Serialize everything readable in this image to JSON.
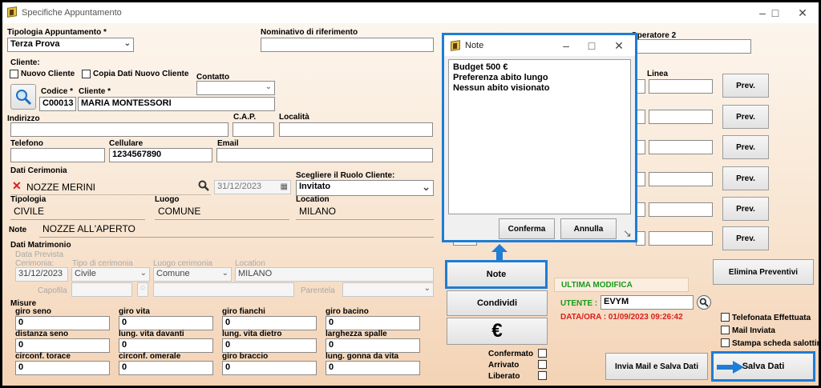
{
  "window": {
    "title": "Specifiche Appuntamento"
  },
  "top": {
    "tipologia_label": "Tipologia Appuntamento *",
    "tipologia_value": "Terza Prova",
    "nominativo_label": "Nominativo di riferimento",
    "nominativo_value": "",
    "operatore_label": "Operatore 2"
  },
  "cliente": {
    "section_label": "Cliente:",
    "nuovo_label": "Nuovo Cliente",
    "copia_label": "Copia Dati Nuovo Cliente",
    "contatto_label": "Contatto",
    "codice_label": "Codice *",
    "codice_value": "C00013",
    "cliente_label": "Cliente *",
    "cliente_value": "MARIA  MONTESSORI",
    "indirizzo_label": "Indirizzo",
    "cap_label": "C.A.P.",
    "localita_label": "Località",
    "telefono_label": "Telefono",
    "cellulare_label": "Cellulare",
    "cellulare_value": "1234567890",
    "email_label": "Email"
  },
  "cerimonia": {
    "section_label": "Dati Cerimonia",
    "name_value": "NOZZE MERINI",
    "date_value": "31/12/2023",
    "ruolo_label": "Scegliere il Ruolo Cliente:",
    "ruolo_value": "Invitato",
    "tipologia_label": "Tipologia",
    "tipologia_value": "CIVILE",
    "luogo_label": "Luogo",
    "luogo_value": "COMUNE",
    "location_label": "Location",
    "location_value": "MILANO",
    "note_label": "Note",
    "note_value": "NOZZE ALL'APERTO"
  },
  "matrimonio": {
    "section_label": "Dati Matrimonio",
    "data_prevista_label": "Data Prevista",
    "cerimonia_label": "Cerimonia:",
    "cerimonia_value": "31/12/2023",
    "tipo_label": "Tipo di cerimonia",
    "tipo_value": "Civile",
    "luogo_label": "Luogo cerimonia",
    "luogo_value": "Comune",
    "location_label": "Location",
    "location_value": "MILANO",
    "capofila_label": "Capofila",
    "parentela_label": "Parentela"
  },
  "misure": {
    "section_label": "Misure",
    "fields": [
      {
        "label": "giro seno",
        "value": "0"
      },
      {
        "label": "giro vita",
        "value": "0"
      },
      {
        "label": "giro fianchi",
        "value": "0"
      },
      {
        "label": "giro bacino",
        "value": "0"
      },
      {
        "label": "distanza seno",
        "value": "0"
      },
      {
        "label": "lung. vita davanti",
        "value": "0"
      },
      {
        "label": "lung. vita dietro",
        "value": "0"
      },
      {
        "label": "larghezza spalle",
        "value": "0"
      },
      {
        "label": "circonf. torace",
        "value": "0"
      },
      {
        "label": "circonf. omerale",
        "value": "0"
      },
      {
        "label": "giro braccio",
        "value": "0"
      },
      {
        "label": "lung. gonna da vita",
        "value": "0"
      }
    ]
  },
  "note_dialog": {
    "title": "Note",
    "lines": [
      "Budget 500 €",
      "Preferenza abito lungo",
      "Nessun abito visionato"
    ],
    "confirm_label": "Conferma",
    "cancel_label": "Annulla"
  },
  "middle": {
    "note_button": "Note",
    "condividi_button": "Condividi",
    "euro_symbol": "€",
    "confermato_label": "Confermato",
    "arrivato_label": "Arrivato",
    "liberato_label": "Liberato"
  },
  "right": {
    "linea_label": "Linea",
    "prev_label": "Prev.",
    "elimina_label": "Elimina Preventivi",
    "ultima_label": "ULTIMA MODIFICA",
    "utente_label": "UTENTE :",
    "utente_value": "EVYM",
    "dataora_label": "DATA/ORA : 01/09/2023 09:26:42",
    "telefonata_label": "Telefonata Effettuata",
    "mail_label": "Mail Inviata",
    "stampa_label": "Stampa scheda salottino",
    "invia_label": "Invia Mail e Salva Dati",
    "salva_label": "Salva Dati"
  },
  "colors": {
    "highlight": "#1e7dd4",
    "green": "#1a9a1a",
    "red": "#d81e1e",
    "bg_top": "#fdf7f0",
    "bg_bottom": "#f4d3b5"
  }
}
